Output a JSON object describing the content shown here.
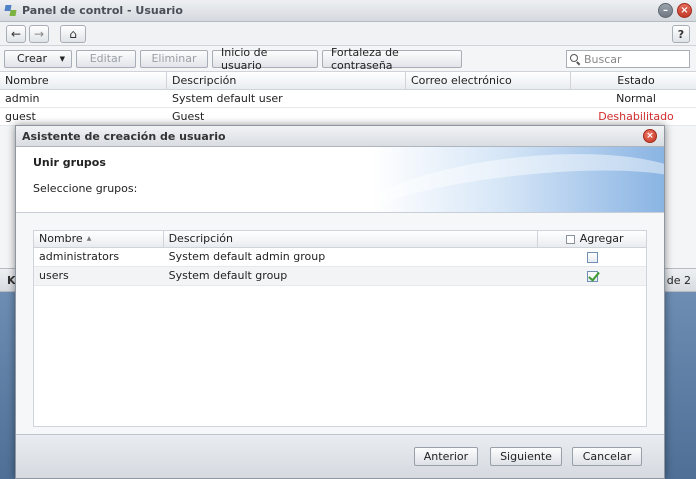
{
  "window": {
    "title": "Panel de control - Usuario"
  },
  "nav": {
    "back_icon": "arrow-left-icon",
    "forward_icon": "arrow-right-icon",
    "home_icon": "home-icon",
    "help_label": "?"
  },
  "toolbar": {
    "create_label": "Crear",
    "edit_label": "Editar",
    "delete_label": "Eliminar",
    "user_home_label": "Inicio de usuario",
    "password_strength_label": "Fortaleza de contraseña",
    "search_placeholder": "Buscar"
  },
  "users_table": {
    "columns": [
      "Nombre",
      "Descripción",
      "Correo electrónico",
      "Estado"
    ],
    "rows": [
      {
        "name": "admin",
        "description": "System default user",
        "email": "",
        "status": "Normal"
      },
      {
        "name": "guest",
        "description": "Guest",
        "email": "",
        "status": "Deshabilitado"
      }
    ]
  },
  "pager": {
    "first_icon": "K",
    "info": "2 de 2"
  },
  "colors": {
    "status_disabled": "#d32f2f",
    "accent_blue": "#8ab4e3"
  },
  "dialog": {
    "title": "Asistente de creación de usuario",
    "step_title": "Unir grupos",
    "step_subtitle": "Seleccione grupos:",
    "groups_table": {
      "columns": [
        "Nombre",
        "Descripción",
        "Agregar"
      ],
      "rows": [
        {
          "name": "administrators",
          "description": "System default admin group",
          "add": false
        },
        {
          "name": "users",
          "description": "System default group",
          "add": true
        }
      ]
    },
    "buttons": {
      "previous": "Anterior",
      "next": "Siguiente",
      "cancel": "Cancelar"
    }
  }
}
